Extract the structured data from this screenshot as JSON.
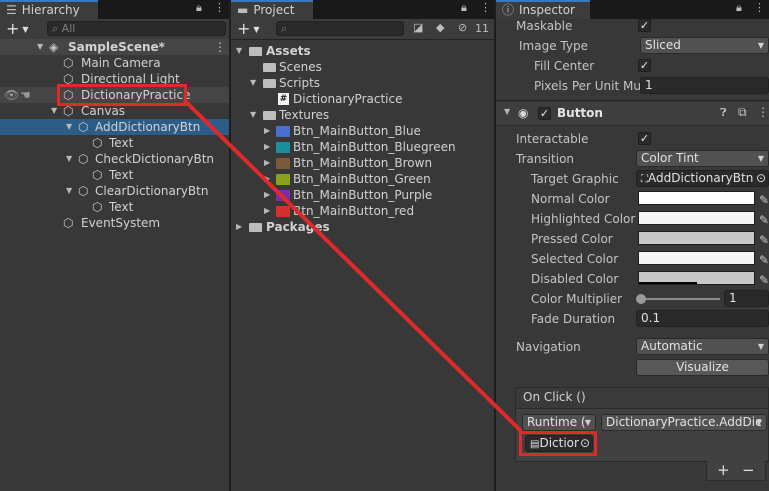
{
  "hierarchy": {
    "tab_label": "Hierarchy",
    "search_placeholder": "All",
    "items": [
      {
        "label": "SampleScene*"
      },
      {
        "label": "Main Camera"
      },
      {
        "label": "Directional Light"
      },
      {
        "label": "DictionaryPractice"
      },
      {
        "label": "Canvas"
      },
      {
        "label": "AddDictionaryBtn"
      },
      {
        "label": "Text"
      },
      {
        "label": "CheckDictionaryBtn"
      },
      {
        "label": "Text"
      },
      {
        "label": "ClearDictionaryBtn"
      },
      {
        "label": "Text"
      },
      {
        "label": "EventSystem"
      }
    ]
  },
  "project": {
    "tab_label": "Project",
    "hidden_count": "11",
    "items": [
      {
        "label": "Assets"
      },
      {
        "label": "Scenes"
      },
      {
        "label": "Scripts"
      },
      {
        "label": "DictionaryPractice"
      },
      {
        "label": "Textures"
      },
      {
        "label": "Btn_MainButton_Blue",
        "color": "#4a6fd0"
      },
      {
        "label": "Btn_MainButton_Bluegreen",
        "color": "#1c8f9c"
      },
      {
        "label": "Btn_MainButton_Brown",
        "color": "#7a5a3a"
      },
      {
        "label": "Btn_MainButton_Green",
        "color": "#8aa11e"
      },
      {
        "label": "Btn_MainButton_Purple",
        "color": "#7a2ea8"
      },
      {
        "label": "Btn_MainButton_red",
        "color": "#d43030"
      },
      {
        "label": "Packages"
      }
    ]
  },
  "inspector": {
    "tab_label": "Inspector",
    "image": {
      "maskable_label": "Maskable",
      "image_type_label": "Image Type",
      "image_type_value": "Sliced",
      "fill_center_label": "Fill Center",
      "ppu_label": "Pixels Per Unit Mul",
      "ppu_value": "1"
    },
    "button": {
      "title": "Button",
      "interactable_label": "Interactable",
      "transition_label": "Transition",
      "transition_value": "Color Tint",
      "target_graphic_label": "Target Graphic",
      "target_graphic_value": "AddDictionaryBtn",
      "colors": [
        {
          "label": "Normal Color",
          "color": "#ffffff"
        },
        {
          "label": "Highlighted Color",
          "color": "#f5f5f5"
        },
        {
          "label": "Pressed Color",
          "color": "#c8c8c8"
        },
        {
          "label": "Selected Color",
          "color": "#f5f5f5"
        },
        {
          "label": "Disabled Color",
          "color": "#c8c8c8",
          "alpha": 0.5
        }
      ],
      "color_multiplier_label": "Color Multiplier",
      "color_multiplier_value": "1",
      "fade_duration_label": "Fade Duration",
      "fade_duration_value": "0.1",
      "navigation_label": "Navigation",
      "navigation_value": "Automatic",
      "visualize_label": "Visualize"
    },
    "onclick": {
      "header": "On Click ()",
      "runtime_value": "Runtime (",
      "function_value": "DictionaryPractice.AddDic",
      "object_value": "Dictior",
      "add_label": "+",
      "remove_label": "−"
    }
  },
  "annotation_color": "#e02a2a"
}
